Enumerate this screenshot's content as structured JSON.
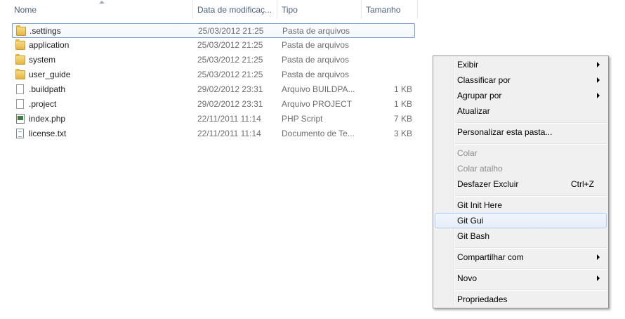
{
  "columns": {
    "name": "Nome",
    "date": "Data de modificaç...",
    "type": "Tipo",
    "size": "Tamanho"
  },
  "files": [
    {
      "name": ".settings",
      "date": "25/03/2012 21:25",
      "type": "Pasta de arquivos",
      "size": "",
      "icon": "folder-icon"
    },
    {
      "name": "application",
      "date": "25/03/2012 21:25",
      "type": "Pasta de arquivos",
      "size": "",
      "icon": "folder-icon"
    },
    {
      "name": "system",
      "date": "25/03/2012 21:25",
      "type": "Pasta de arquivos",
      "size": "",
      "icon": "folder-icon"
    },
    {
      "name": "user_guide",
      "date": "25/03/2012 21:25",
      "type": "Pasta de arquivos",
      "size": "",
      "icon": "folder-icon"
    },
    {
      "name": ".buildpath",
      "date": "29/02/2012 23:31",
      "type": "Arquivo BUILDPA...",
      "size": "1 KB",
      "icon": "file-icon"
    },
    {
      "name": ".project",
      "date": "29/02/2012 23:31",
      "type": "Arquivo PROJECT",
      "size": "1 KB",
      "icon": "file-icon"
    },
    {
      "name": "index.php",
      "date": "22/11/2011 11:14",
      "type": "PHP Script",
      "size": "7 KB",
      "icon": "php-file-icon"
    },
    {
      "name": "license.txt",
      "date": "22/11/2011 11:14",
      "type": "Documento de Te...",
      "size": "3 KB",
      "icon": "text-file-icon"
    }
  ],
  "menu": {
    "view": "Exibir",
    "sort_by": "Classificar por",
    "group_by": "Agrupar por",
    "refresh": "Atualizar",
    "customize": "Personalizar esta pasta...",
    "paste": "Colar",
    "paste_shortcut": "Colar atalho",
    "undo_delete": "Desfazer Excluir",
    "undo_delete_shortcut": "Ctrl+Z",
    "git_init": "Git Init Here",
    "git_gui": "Git Gui",
    "git_bash": "Git Bash",
    "share_with": "Compartilhar com",
    "new": "Novo",
    "properties": "Propriedades"
  }
}
